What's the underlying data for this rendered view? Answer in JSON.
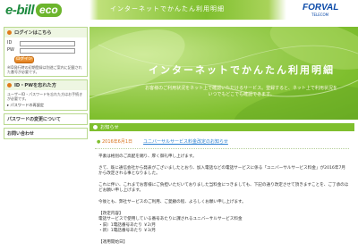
{
  "header": {
    "logo_main": "e-bill",
    "logo_badge": "eco",
    "tagline": "インターネットでかんたん利用明細",
    "brand": "FORVAL",
    "brand_sub": "TELECOM"
  },
  "login": {
    "title": "ログインはこちら",
    "id_label": "ID",
    "pw_label": "PW",
    "button": "ログイン",
    "note": "※ID発行時の初期登録は別途ご案内に記載された番号が必要です。"
  },
  "idpw": {
    "title": "ID・PWを忘れた方",
    "text": "ユーザーID・パスワードを忘れた方はお手続きが必要です。",
    "link": "▸ パスワードの再設定"
  },
  "side_links": [
    "パスワードの変更について",
    "お問い合わせ"
  ],
  "hero": {
    "title": "インターネットでかんたん利用明細",
    "subtitle": "お客様のご利用状況をネット上で確認いただけるサービス。登録すると、ネット上で利用状況をいつでもどこでも確認できます。"
  },
  "news": {
    "header": "お知らせ",
    "date": "2016年6月1日",
    "title": "ユニバーサルサービス料金改定のお知らせ"
  },
  "body_paragraphs": [
    "平素は格別のご高配を賜り、厚く御礼申し上げます。",
    "さて、既に通信会社から発表がございましたとおり、加入電話などの電話サービスに係る「ユニバーサルサービス料金」が2016年7月から改定される事となりました。",
    "これに伴い、これまでお客様にご負担いただいておりました当料金につきましても、下記の通り改定させて頂きますことを、ご了承のほどお願い申し上げます。",
    "今後とも、弊社サービスのご利用、ご愛顧の程、よろしくお願い申し上げます。",
    "【改定内容】",
    "電話サービスで使用している番号あたりに課されるユニバーサルサービス料金",
    "・旧）1電話番号あたり ￥2/月",
    "・新）1電話番号あたり ￥3/月",
    "【適用開始日】"
  ],
  "colors": {
    "brand_green": "#7fbf2e",
    "dark_green": "#1d8a3e",
    "accent_orange": "#e07b1a",
    "link_blue": "#2a7fcf"
  }
}
